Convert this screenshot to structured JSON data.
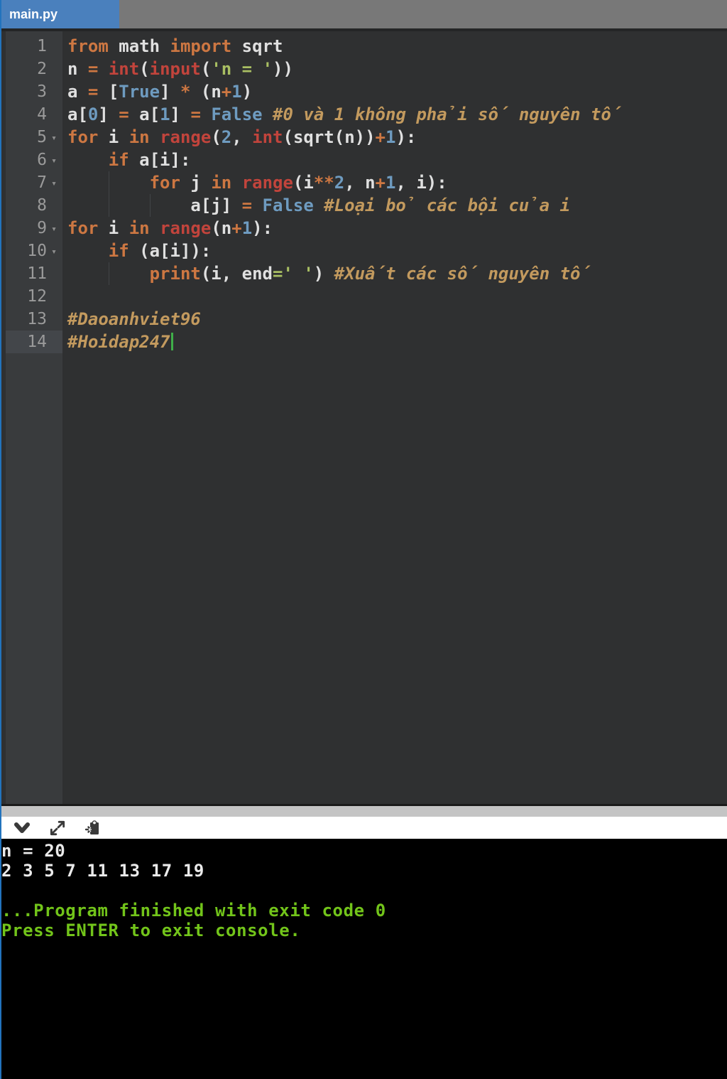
{
  "window": {
    "tab_title": "main.py"
  },
  "colors": {
    "tab_accent_blue": "#4a80bd",
    "left_edge_blue": "#2273bd",
    "keyword_orange": "#cd7742",
    "function_red": "#c2443c",
    "number_blue": "#6e9bc0",
    "string_green": "#a9bf63",
    "comment_tan": "#c39a5e",
    "cursor_green": "#3fae49",
    "console_green": "#72c41a"
  },
  "editor": {
    "lines": [
      {
        "n": 1,
        "fold": false,
        "indent": 0,
        "tokens": [
          [
            "kw",
            "from"
          ],
          [
            "pl",
            " math "
          ],
          [
            "kw",
            "import"
          ],
          [
            "pl",
            " sqrt"
          ]
        ]
      },
      {
        "n": 2,
        "fold": false,
        "indent": 0,
        "tokens": [
          [
            "pl",
            "n "
          ],
          [
            "op",
            "="
          ],
          [
            "pl",
            " "
          ],
          [
            "fn",
            "int"
          ],
          [
            "pl",
            "("
          ],
          [
            "fn",
            "input"
          ],
          [
            "pl",
            "("
          ],
          [
            "st",
            "'n = '"
          ],
          [
            "pl",
            "))"
          ]
        ]
      },
      {
        "n": 3,
        "fold": false,
        "indent": 0,
        "tokens": [
          [
            "pl",
            "a "
          ],
          [
            "op",
            "="
          ],
          [
            "pl",
            " ["
          ],
          [
            "num",
            "True"
          ],
          [
            "pl",
            "] "
          ],
          [
            "op",
            "*"
          ],
          [
            "pl",
            " (n"
          ],
          [
            "op",
            "+"
          ],
          [
            "num",
            "1"
          ],
          [
            "pl",
            ")"
          ]
        ]
      },
      {
        "n": 4,
        "fold": false,
        "indent": 0,
        "tokens": [
          [
            "pl",
            "a["
          ],
          [
            "num",
            "0"
          ],
          [
            "pl",
            "] "
          ],
          [
            "op",
            "="
          ],
          [
            "pl",
            " a["
          ],
          [
            "num",
            "1"
          ],
          [
            "pl",
            "] "
          ],
          [
            "op",
            "="
          ],
          [
            "pl",
            " "
          ],
          [
            "num",
            "False"
          ],
          [
            "pl",
            " "
          ],
          [
            "com",
            "#0 và 1 không phải số nguyên tố"
          ]
        ]
      },
      {
        "n": 5,
        "fold": true,
        "indent": 0,
        "tokens": [
          [
            "kw",
            "for"
          ],
          [
            "pl",
            " i "
          ],
          [
            "kw",
            "in"
          ],
          [
            "pl",
            " "
          ],
          [
            "fn",
            "range"
          ],
          [
            "pl",
            "("
          ],
          [
            "num",
            "2"
          ],
          [
            "pl",
            ", "
          ],
          [
            "fn",
            "int"
          ],
          [
            "pl",
            "(sqrt(n))"
          ],
          [
            "op",
            "+"
          ],
          [
            "num",
            "1"
          ],
          [
            "pl",
            "):"
          ]
        ]
      },
      {
        "n": 6,
        "fold": true,
        "indent": 1,
        "tokens": [
          [
            "kw",
            "if"
          ],
          [
            "pl",
            " a[i]:"
          ]
        ]
      },
      {
        "n": 7,
        "fold": true,
        "indent": 2,
        "tokens": [
          [
            "kw",
            "for"
          ],
          [
            "pl",
            " j "
          ],
          [
            "kw",
            "in"
          ],
          [
            "pl",
            " "
          ],
          [
            "fn",
            "range"
          ],
          [
            "pl",
            "(i"
          ],
          [
            "op",
            "**"
          ],
          [
            "num",
            "2"
          ],
          [
            "pl",
            ", n"
          ],
          [
            "op",
            "+"
          ],
          [
            "num",
            "1"
          ],
          [
            "pl",
            ", i):"
          ]
        ]
      },
      {
        "n": 8,
        "fold": false,
        "indent": 3,
        "tokens": [
          [
            "pl",
            "a[j] "
          ],
          [
            "op",
            "="
          ],
          [
            "pl",
            " "
          ],
          [
            "num",
            "False"
          ],
          [
            "pl",
            " "
          ],
          [
            "com",
            "#Loại bỏ các bội của i"
          ]
        ]
      },
      {
        "n": 9,
        "fold": true,
        "indent": 0,
        "tokens": [
          [
            "kw",
            "for"
          ],
          [
            "pl",
            " i "
          ],
          [
            "kw",
            "in"
          ],
          [
            "pl",
            " "
          ],
          [
            "fn",
            "range"
          ],
          [
            "pl",
            "(n"
          ],
          [
            "op",
            "+"
          ],
          [
            "num",
            "1"
          ],
          [
            "pl",
            "):"
          ]
        ]
      },
      {
        "n": 10,
        "fold": true,
        "indent": 1,
        "tokens": [
          [
            "kw",
            "if"
          ],
          [
            "pl",
            " (a[i]):"
          ]
        ]
      },
      {
        "n": 11,
        "fold": false,
        "indent": 2,
        "tokens": [
          [
            "kw",
            "print"
          ],
          [
            "pl",
            "(i, end"
          ],
          [
            "st",
            "=' '"
          ],
          [
            "pl",
            ") "
          ],
          [
            "com",
            "#Xuất các số nguyên tố"
          ]
        ]
      },
      {
        "n": 12,
        "fold": false,
        "indent": 0,
        "tokens": []
      },
      {
        "n": 13,
        "fold": false,
        "indent": 0,
        "tokens": [
          [
            "com",
            "#Daoanhviet96"
          ]
        ]
      },
      {
        "n": 14,
        "fold": false,
        "indent": 0,
        "active": true,
        "tokens": [
          [
            "com",
            "#Hoidap247"
          ],
          [
            "cursor",
            ""
          ]
        ]
      }
    ]
  },
  "console": {
    "toolbar_icons": [
      "collapse-console",
      "expand-console",
      "clipboard-paste"
    ],
    "lines": [
      {
        "text": "n = 20",
        "color": "white"
      },
      {
        "text": "2 3 5 7 11 13 17 19",
        "color": "white"
      },
      {
        "text": "",
        "color": "white"
      },
      {
        "text": "...Program finished with exit code 0",
        "color": "green"
      },
      {
        "text": "Press ENTER to exit console.",
        "color": "green"
      }
    ]
  }
}
